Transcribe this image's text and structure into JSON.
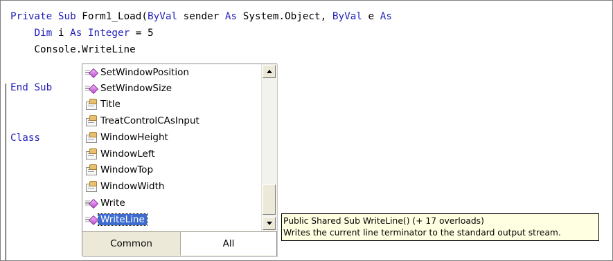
{
  "code": {
    "line1": {
      "kw1": "Private",
      "t1": " ",
      "kw2": "Sub",
      "t2": " Form1_Load(",
      "kw3": "ByVal",
      "t3": " sender ",
      "kw4": "As",
      "t4": " System.Object, ",
      "kw5": "ByVal",
      "t5": " e ",
      "kw6": "As"
    },
    "line2": {
      "indent": "    ",
      "kw1": "Dim",
      "t1": " i ",
      "kw2": "As",
      "t2": " ",
      "kw3": "Integer",
      "t3": " = 5"
    },
    "line3": {
      "text": "    Console.WriteLine"
    },
    "line4": {
      "kw1": "End",
      "t1": " ",
      "kw2": "Sub"
    },
    "line5": {
      "kw1": "Class"
    }
  },
  "intellisense": {
    "items": [
      {
        "label": "SetWindowPosition",
        "icon": "method-icon"
      },
      {
        "label": "SetWindowSize",
        "icon": "method-icon"
      },
      {
        "label": "Title",
        "icon": "property-icon"
      },
      {
        "label": "TreatControlCAsInput",
        "icon": "property-icon"
      },
      {
        "label": "WindowHeight",
        "icon": "property-icon"
      },
      {
        "label": "WindowLeft",
        "icon": "property-icon"
      },
      {
        "label": "WindowTop",
        "icon": "property-icon"
      },
      {
        "label": "WindowWidth",
        "icon": "property-icon"
      },
      {
        "label": "Write",
        "icon": "method-icon"
      },
      {
        "label": "WriteLine",
        "icon": "method-icon",
        "selected": true
      }
    ],
    "tabs": {
      "common": "Common",
      "all": "All",
      "active": "All"
    }
  },
  "tooltip": {
    "line1": "Public Shared Sub WriteLine() (+ 17 overloads)",
    "line2": "Writes the current line terminator to the standard output stream."
  },
  "colors": {
    "keyword": "#1f1fb7",
    "selection": "#3d6bd0",
    "tooltip_bg": "#ffffe1",
    "tab_bg": "#ece9d8"
  }
}
